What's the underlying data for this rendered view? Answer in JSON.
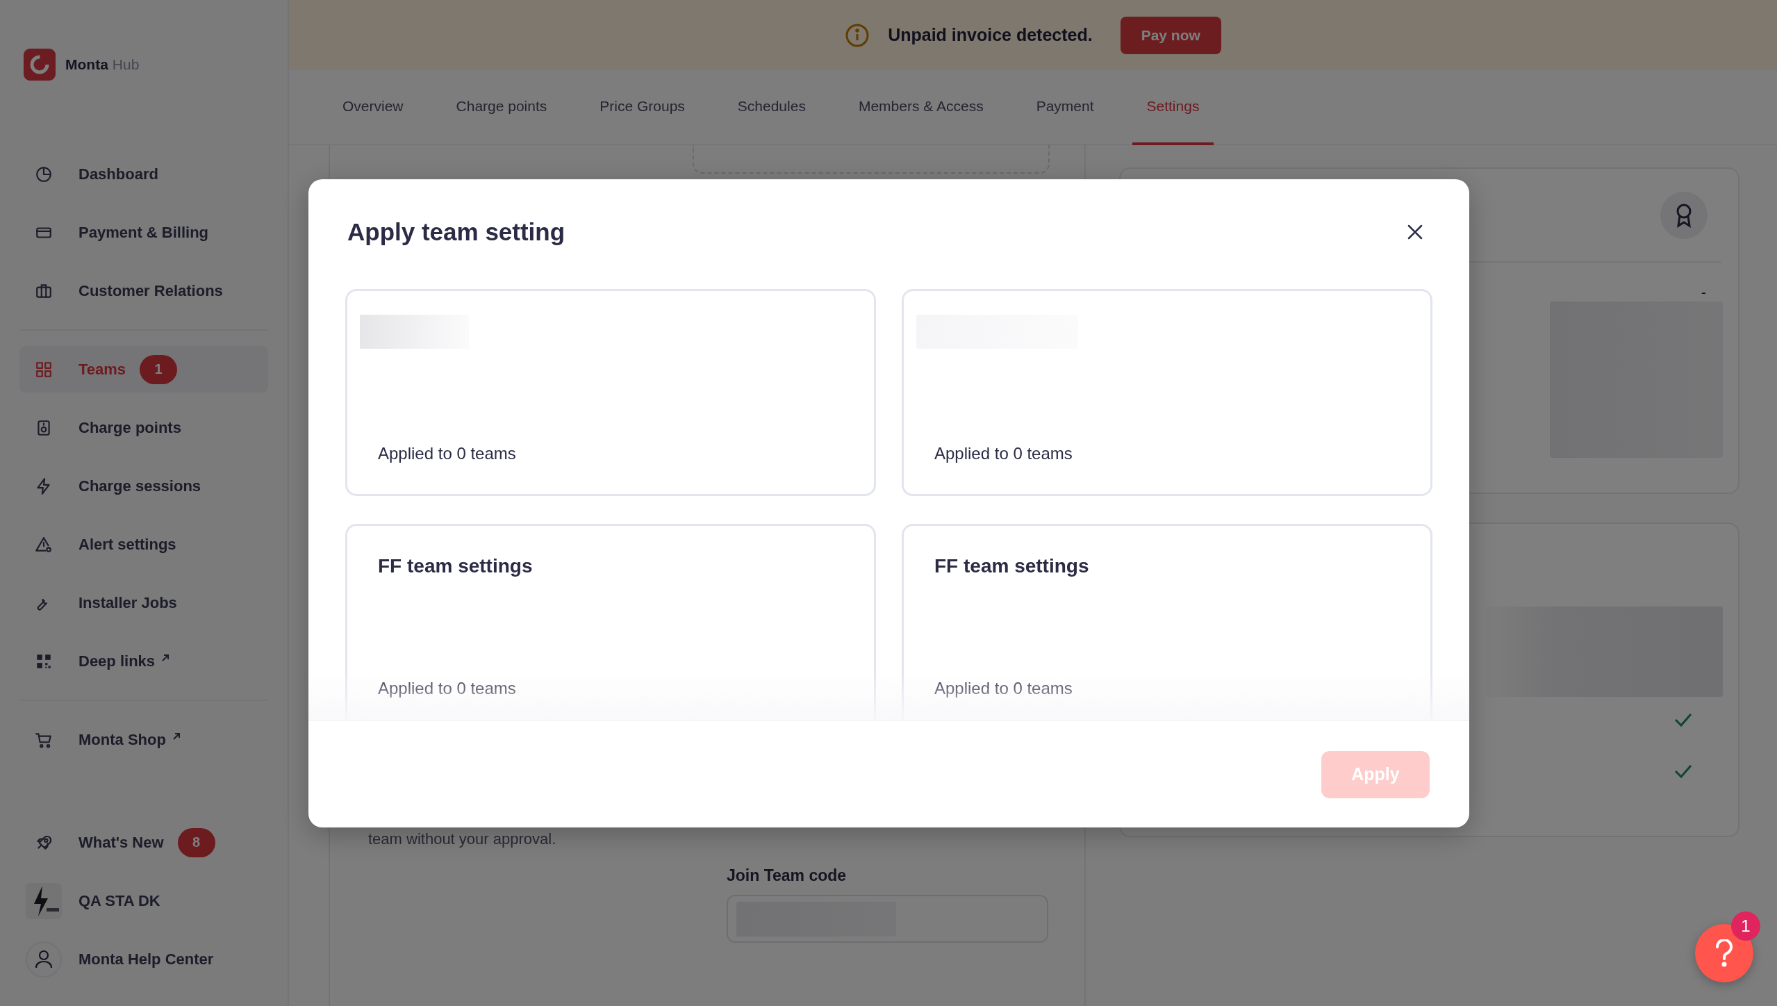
{
  "sidebar": {
    "brand": {
      "name": "Monta",
      "product": "Hub"
    },
    "groups": [
      {
        "items": [
          {
            "label": "Dashboard",
            "selected": false,
            "external": false
          },
          {
            "label": "Payment & Billing",
            "selected": false,
            "external": false
          },
          {
            "label": "Customer Relations",
            "selected": false,
            "external": false
          }
        ]
      },
      {
        "items": [
          {
            "label": "Teams",
            "selected": true,
            "external": false,
            "badge": "1"
          },
          {
            "label": "Charge points",
            "selected": false,
            "external": false
          },
          {
            "label": "Charge sessions",
            "selected": false,
            "external": false
          },
          {
            "label": "Alert settings",
            "selected": false,
            "external": false
          },
          {
            "label": "Installer Jobs",
            "selected": false,
            "external": false
          },
          {
            "label": "Deep links",
            "selected": false,
            "external": true
          }
        ]
      },
      {
        "items": [
          {
            "label": "Monta Shop",
            "selected": false,
            "external": true
          }
        ]
      },
      {
        "items": [
          {
            "label": "What's New",
            "selected": false,
            "external": false,
            "badge": "8"
          },
          {
            "label": "QA STA DK",
            "selected": false,
            "external": false
          },
          {
            "label": "Monta Help Center",
            "selected": false,
            "external": false
          }
        ]
      }
    ]
  },
  "banner": {
    "message": "Unpaid invoice detected.",
    "action": "Pay now"
  },
  "tabs": [
    {
      "label": "Overview",
      "selected": false
    },
    {
      "label": "Charge points",
      "selected": false
    },
    {
      "label": "Price Groups",
      "selected": false
    },
    {
      "label": "Schedules",
      "selected": false
    },
    {
      "label": "Members & Access",
      "selected": false
    },
    {
      "label": "Payment",
      "selected": false
    },
    {
      "label": "Settings",
      "selected": true
    }
  ],
  "background": {
    "notice": "team without your approval.",
    "join_code": {
      "label": "Join Team code"
    },
    "right_value": "-"
  },
  "modal": {
    "title": "Apply team setting",
    "cards": [
      {
        "kind": "loading",
        "footer": "Applied to 0 teams"
      },
      {
        "kind": "loading",
        "footer": "Applied to 0 teams"
      },
      {
        "kind": "titled",
        "title": "FF team settings",
        "footer": "Applied to 0 teams"
      },
      {
        "kind": "titled",
        "title": "FF team settings",
        "footer": "Applied to 0 teams"
      }
    ],
    "apply": {
      "label": "Apply",
      "disabled": true
    }
  },
  "help": {
    "badge": "1"
  }
}
